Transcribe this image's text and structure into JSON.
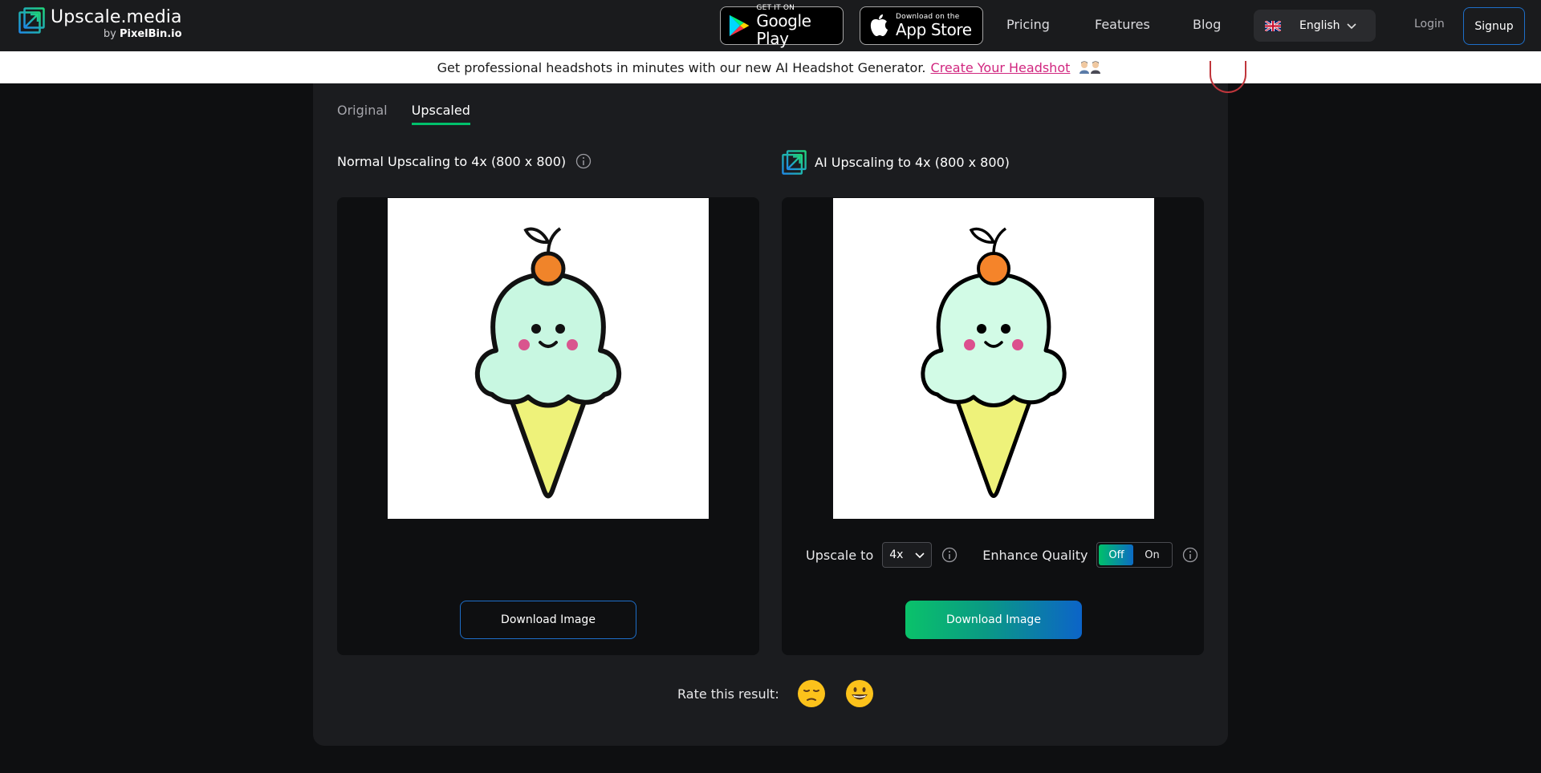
{
  "header": {
    "logo_name": "Upscale.media",
    "logo_by_prefix": "by",
    "logo_by_brand": "PixelBin.io",
    "google_play": {
      "small": "GET IT ON",
      "big": "Google Play"
    },
    "app_store": {
      "small": "Download on the",
      "big": "App Store"
    },
    "nav": {
      "pricing": "Pricing",
      "features": "Features",
      "blog": "Blog"
    },
    "language": "English",
    "login": "Login",
    "signup": "Signup"
  },
  "banner": {
    "text": "Get professional headshots in minutes with our new AI Headshot Generator.",
    "link": "Create Your Headshot"
  },
  "tabs": [
    {
      "label": "Original",
      "active": false
    },
    {
      "label": "Upscaled",
      "active": true
    }
  ],
  "left_panel": {
    "title": "Normal Upscaling to 4x (800 x 800)",
    "download": "Download Image"
  },
  "right_panel": {
    "title": "AI Upscaling to 4x (800 x 800)",
    "upscale_label": "Upscale to",
    "upscale_value": "4x",
    "enhance_label": "Enhance Quality",
    "toggle_off": "Off",
    "toggle_on": "On",
    "toggle_state": "Off",
    "download": "Download Image"
  },
  "rating": {
    "label": "Rate this result:",
    "options": [
      "sad-face-icon",
      "happy-face-icon"
    ]
  },
  "colors": {
    "accent_green": "#00c06b",
    "accent_blue": "#1e6ec8",
    "banner_link": "#d1267f"
  }
}
